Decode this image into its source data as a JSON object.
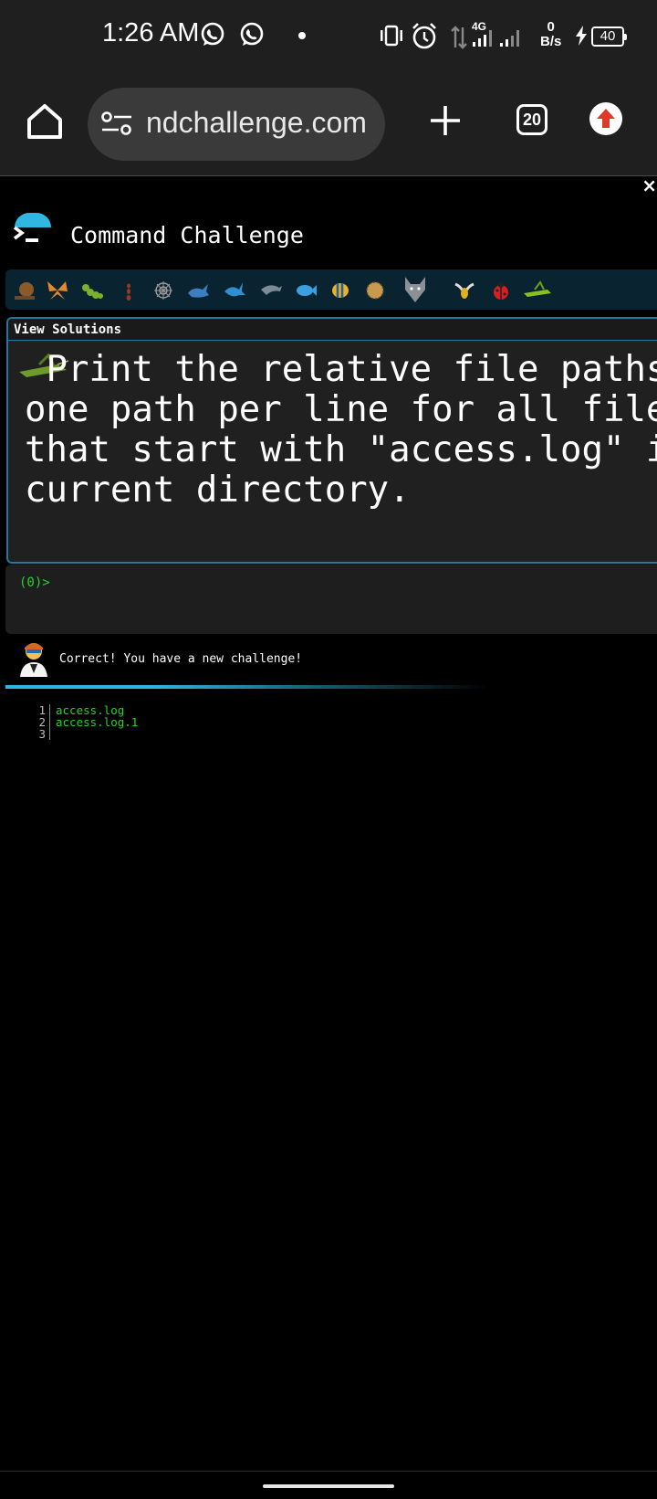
{
  "status_bar": {
    "time": "1:26 AM",
    "network_type": "4G",
    "net_speed_value": "0",
    "net_speed_unit": "B/s",
    "battery": "40"
  },
  "browser": {
    "url": "ndchallenge.com",
    "tab_count": "20"
  },
  "page": {
    "close_label": "×",
    "site_title": "Command Challenge",
    "critters": [
      "snail-icon",
      "butterfly-icon",
      "caterpillar-icon",
      "ant-icon",
      "spider-icon",
      "whale-icon",
      "shark-icon",
      "dolphin-icon",
      "fish-icon",
      "tropical-fish-icon",
      "pufferfish-icon",
      "wolf-icon",
      "bee-icon",
      "ladybug-icon",
      "grasshopper-icon"
    ],
    "view_solutions": "View Solutions",
    "challenge_text": " Print the relative file paths,\none path per line for all files\nthat start with \"access.log\" in the\ncurrent directory.",
    "prompt": "(0)>",
    "message": "Correct! You have a new challenge!",
    "progress_fraction": 0.75,
    "output": [
      {
        "n": "1",
        "text": "access.log"
      },
      {
        "n": "2",
        "text": "access.log.1"
      },
      {
        "n": "3",
        "text": ""
      }
    ]
  },
  "colors": {
    "accent": "#2fb7e0",
    "prompt_green": "#27d427",
    "update_badge": "#e0392a"
  }
}
